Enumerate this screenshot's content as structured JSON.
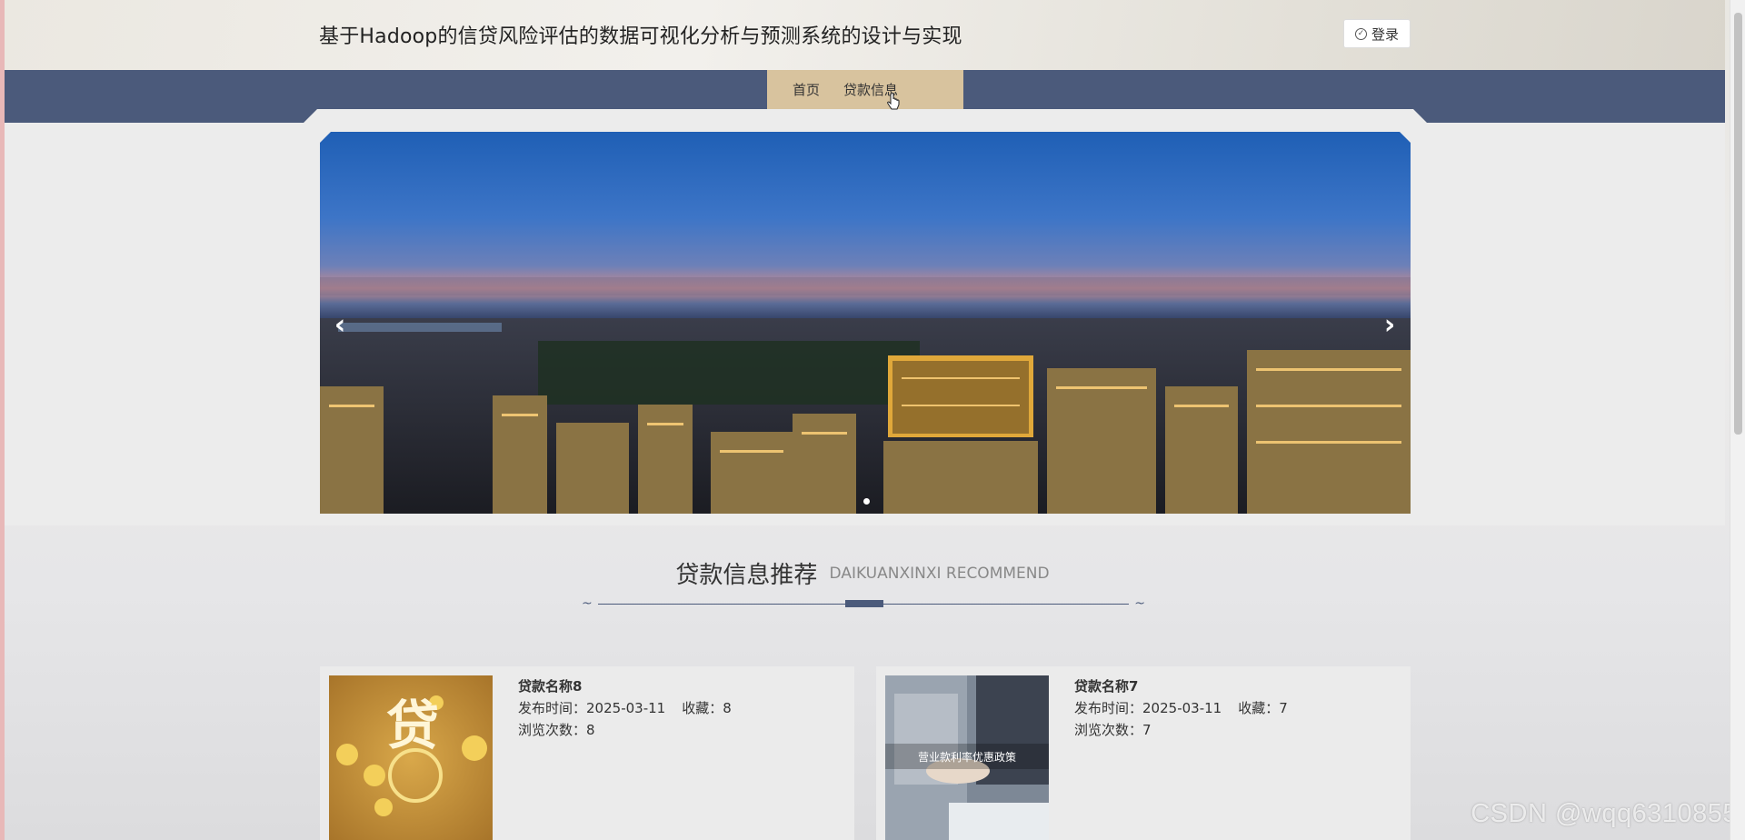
{
  "header": {
    "title": "基于Hadoop的信贷风险评估的数据可视化分析与预测系统的设计与实现",
    "login_label": "登录"
  },
  "nav": {
    "items": [
      {
        "label": "首页"
      },
      {
        "label": "贷款信息"
      }
    ]
  },
  "carousel": {
    "prev_glyph": "‹",
    "next_glyph": "›",
    "slide_count": 1,
    "active_slide": 1
  },
  "section": {
    "title_cn": "贷款信息推荐",
    "title_en": "DAIKUANXINXI RECOMMEND"
  },
  "cards": [
    {
      "name": "贷款名称8",
      "publish_label": "发布时间：",
      "publish_date": "2025-03-11",
      "fav_label": "收藏：",
      "fav_count": "8",
      "views_label": "浏览次数：",
      "views_count": "8",
      "image_text": "贷"
    },
    {
      "name": "贷款名称7",
      "publish_label": "发布时间：",
      "publish_date": "2025-03-11",
      "fav_label": "收藏：",
      "fav_count": "7",
      "views_label": "浏览次数：",
      "views_count": "7",
      "image_text": "营业款利率优惠政策"
    }
  ],
  "watermark": "CSDN @wqq6310855",
  "colors": {
    "nav_bg": "#4b5a7b",
    "nav_active": "#d8c39e",
    "page_bg": "#ececec"
  }
}
